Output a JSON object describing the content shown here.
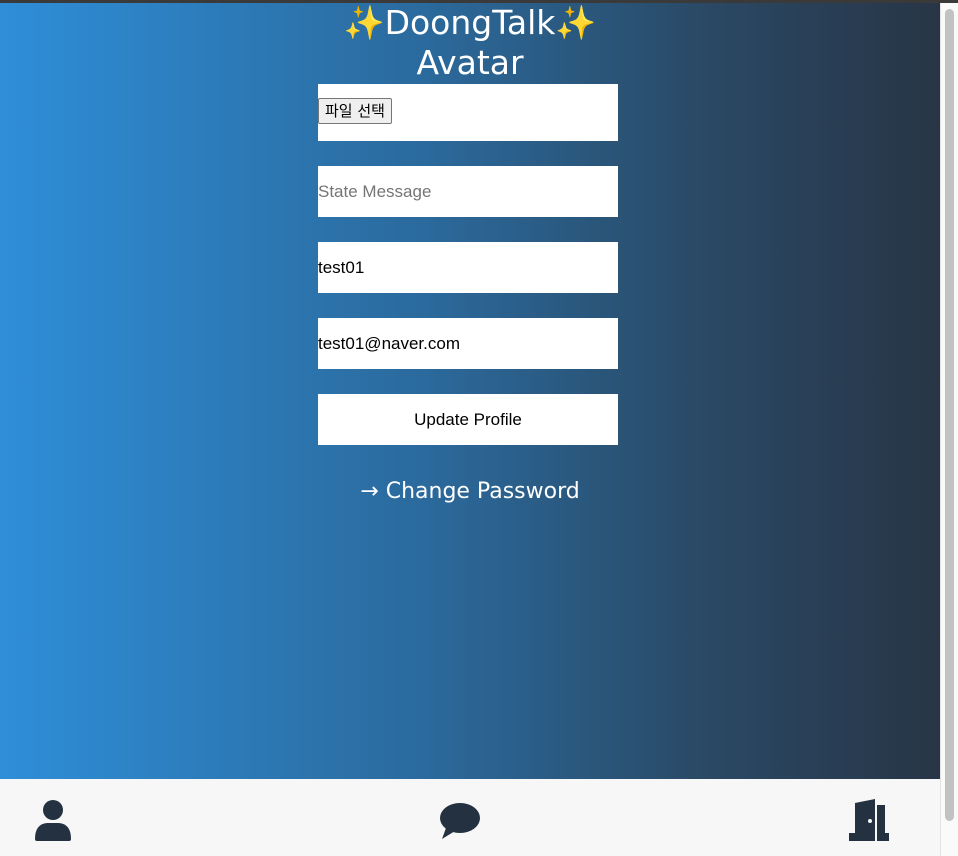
{
  "header": {
    "title_line1": "✨DoongTalk✨",
    "title_line2": "Avatar"
  },
  "form": {
    "file_button_label": "파일 선택",
    "state_message": {
      "value": "",
      "placeholder": "State Message"
    },
    "username": {
      "value": "test01",
      "placeholder": ""
    },
    "email": {
      "value": "test01@naver.com",
      "placeholder": ""
    },
    "update_label": "Update Profile",
    "change_password_link": "→ Change Password"
  },
  "nav": {
    "items": [
      {
        "icon": "user-icon"
      },
      {
        "icon": "chat-bubble-icon"
      },
      {
        "icon": "door-exit-icon"
      }
    ]
  },
  "colors": {
    "gradient_start": "#2e8ed8",
    "gradient_end": "#283546",
    "icon_color": "#243140"
  }
}
